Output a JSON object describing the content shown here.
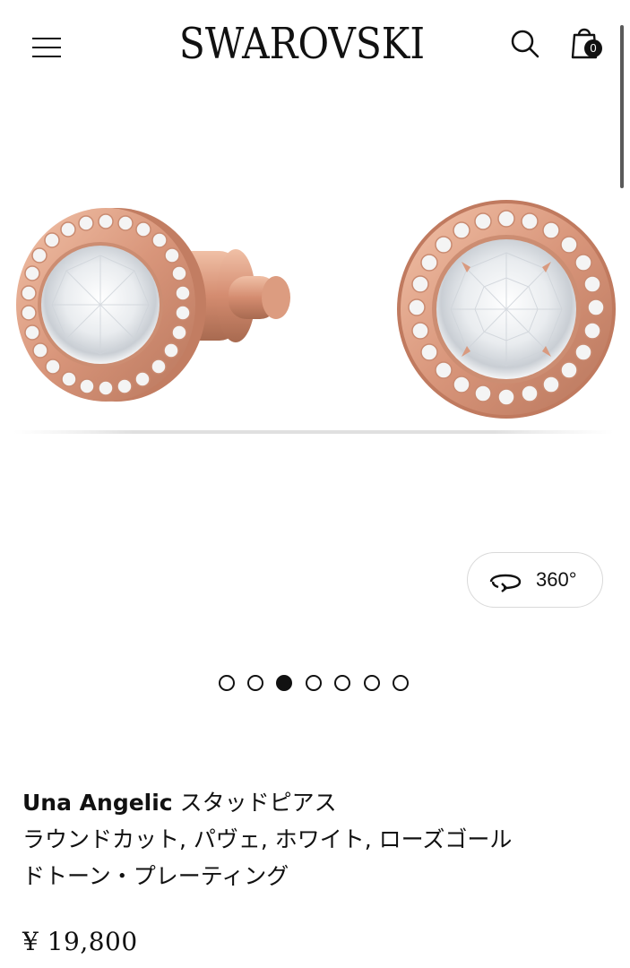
{
  "header": {
    "logo": "SWAROVSKI",
    "menu_icon": "hamburger-menu-icon",
    "search_icon": "search-icon",
    "bag_icon": "shopping-bag-icon",
    "bag_count": "0"
  },
  "gallery": {
    "view_360_label": "360°",
    "view_360_icon": "rotate-360-icon",
    "slide_count": 7,
    "active_slide_index": 3
  },
  "product": {
    "name_bold": "Una Angelic",
    "name_line1_rest": " スタッドピアス",
    "name_line2": "ラウンドカット, パヴェ, ホワイト, ローズゴール",
    "name_line3": "ドトーン・プレーティング",
    "price": "¥ 19,800"
  },
  "colors": {
    "text": "#111111",
    "rose_gold": "#d99a7f",
    "background": "#ffffff"
  }
}
